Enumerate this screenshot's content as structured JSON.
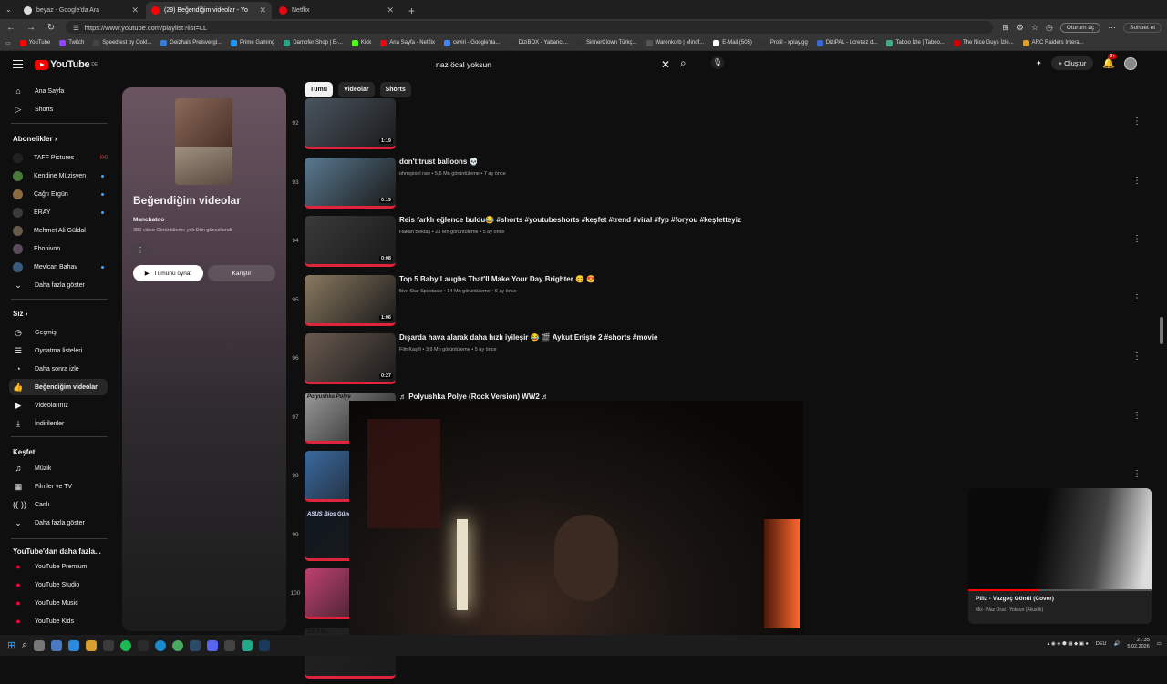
{
  "browser": {
    "tabs": [
      {
        "label": "beyaz - Google'da Ara",
        "active": false
      },
      {
        "label": "(29) Beğendiğim videolar - Yo",
        "active": true
      },
      {
        "label": "Netflix",
        "active": false
      }
    ],
    "url": "https://www.youtube.com/playlist?list=LL",
    "profile_pill": "Oturum aç",
    "chat_label": "Sohbet et",
    "bookmarks": [
      "YouTube",
      "Twitch",
      "Speedtest by Ookl...",
      "Geizhals Preisvergl...",
      "Prime Gaming",
      "Dampfer Shop | E-...",
      "Kick",
      "Ana Sayfa - Netflix",
      "ceviri - Google'da...",
      "DiziBOX - Yabancı...",
      "SinnerClown Türkç...",
      "Warenkorb | Mindf...",
      "E-Mail (505)",
      "Profil - xplay.gg",
      "DiziPAL - ücretsiz d...",
      "Taboo İzle | Taboo...",
      "The Nice Guys İzle...",
      "ARC Raiders Intera..."
    ]
  },
  "header": {
    "logo_text": "YouTube",
    "logo_region": "DE",
    "search_query": "naz öcal yoksun",
    "create_label": "Oluştur",
    "notif_count": "9+"
  },
  "sidebar": {
    "main": [
      {
        "label": "Ana Sayfa",
        "icon": "home-icon"
      },
      {
        "label": "Shorts",
        "icon": "shorts-icon"
      }
    ],
    "subs_header": "Abonelikler",
    "subs": [
      {
        "label": "TAFF Pictures",
        "badge": "live"
      },
      {
        "label": "Kendine Müzisyen",
        "badge": "dot"
      },
      {
        "label": "Çağrı Ergün",
        "badge": "dot"
      },
      {
        "label": "ERAY",
        "badge": "dot"
      },
      {
        "label": "Mehmet Ali Güldal",
        "badge": ""
      },
      {
        "label": "Ebonivon",
        "badge": ""
      },
      {
        "label": "Mevlcan Bahav",
        "badge": "dot"
      }
    ],
    "subs_more": "Daha fazla göster",
    "you_header": "Siz",
    "you": [
      {
        "label": "Geçmiş",
        "icon": "history-icon"
      },
      {
        "label": "Oynatma listeleri",
        "icon": "playlists-icon"
      },
      {
        "label": "Daha sonra izle",
        "icon": "watch-later-icon"
      },
      {
        "label": "Beğendiğim videolar",
        "icon": "like-icon",
        "selected": true
      },
      {
        "label": "Videolarınız",
        "icon": "your-videos-icon"
      },
      {
        "label": "İndirilenler",
        "icon": "download-icon"
      }
    ],
    "explore_header": "Keşfet",
    "explore": [
      {
        "label": "Müzik",
        "icon": "music-icon"
      },
      {
        "label": "Filmler ve TV",
        "icon": "movies-icon"
      },
      {
        "label": "Canlı",
        "icon": "live-icon"
      },
      {
        "label": "Daha fazla göster",
        "icon": "chevron-down-icon"
      }
    ],
    "more_header": "YouTube'dan daha fazla...",
    "more": [
      "YouTube Premium",
      "YouTube Studio",
      "YouTube Music",
      "YouTube Kids"
    ]
  },
  "playlist": {
    "title": "Beğendiğim videolar",
    "owner": "Manchatoo",
    "meta": "386 video  Görüntüleme yok  Dün güncellendi",
    "play_all": "Tümünü oynat",
    "shuffle": "Karıştır"
  },
  "chips": [
    "Tümü",
    "Videolar",
    "Shorts"
  ],
  "videos": [
    {
      "num": "92",
      "title": "",
      "meta": "",
      "duration": "1:19",
      "thumb": "#4a5560"
    },
    {
      "num": "93",
      "title": "don't trust balloons 💀",
      "meta": "ohnepixel raw • 5,6 Mn görüntüleme • 7 ay önce",
      "duration": "0:19",
      "thumb": "#5a7a90"
    },
    {
      "num": "94",
      "title": "Reis farklı eğlence buldu😂 #shorts #youtubeshorts #keşfet #trend #viral #fyp #foryou #keşfetteyiz",
      "meta": "Hakan Bektaş • 23 Mn görüntüleme • 5 ay önce",
      "duration": "0:08",
      "thumb": "#3a3a3a"
    },
    {
      "num": "95",
      "title": "Top 5 Baby Laughs That'll Make Your Day Brighter 😊 😍",
      "meta": "5ive Star Spectacle • 14 Mn görüntüleme • 6 ay önce",
      "duration": "1:06",
      "thumb": "#8a7a60"
    },
    {
      "num": "96",
      "title": "Dışarda hava alarak daha hızlı iyileşir 😂 🎬 Aykut Enişte 2 #shorts #movie",
      "meta": "FilmKaşifi • 3,9 Mn görüntüleme • 5 ay önce",
      "duration": "0:27",
      "thumb": "#6a5a50"
    },
    {
      "num": "97",
      "title": "♬ Polyushka Polye (Rock Version) WW2 ♬",
      "meta": "Basih • 42 B görüntüleme • 10 yıl önce",
      "duration": "",
      "thumb": "#9a9a9a",
      "thumb_caption": "Polyushka Polye"
    },
    {
      "num": "98",
      "title": "",
      "meta": "",
      "duration": "",
      "thumb": "#3a6aa0"
    },
    {
      "num": "99",
      "title": "",
      "meta": "",
      "duration": "",
      "thumb": "#101820",
      "thumb_caption": "ASUS Bios Güncelleme 2025"
    },
    {
      "num": "100",
      "title": "",
      "meta": "",
      "duration": "",
      "thumb": "#c04070"
    },
    {
      "num": "",
      "title": "",
      "meta": "",
      "duration": "",
      "thumb": "#222222",
      "thumb_caption": "CS 2 N..."
    }
  ],
  "miniplayer": {
    "title": "Piliz - Vazgeç Gönül (Cover)",
    "subtitle": "Mix · Naz Öcal · Yoksun (Akustik)"
  },
  "taskbar": {
    "lang": "DEU",
    "time": "21:35",
    "date": "5.02.2026"
  },
  "colors": {
    "accent": "#ff0000",
    "progress": "#e0243c",
    "link": "#3ea6ff"
  }
}
